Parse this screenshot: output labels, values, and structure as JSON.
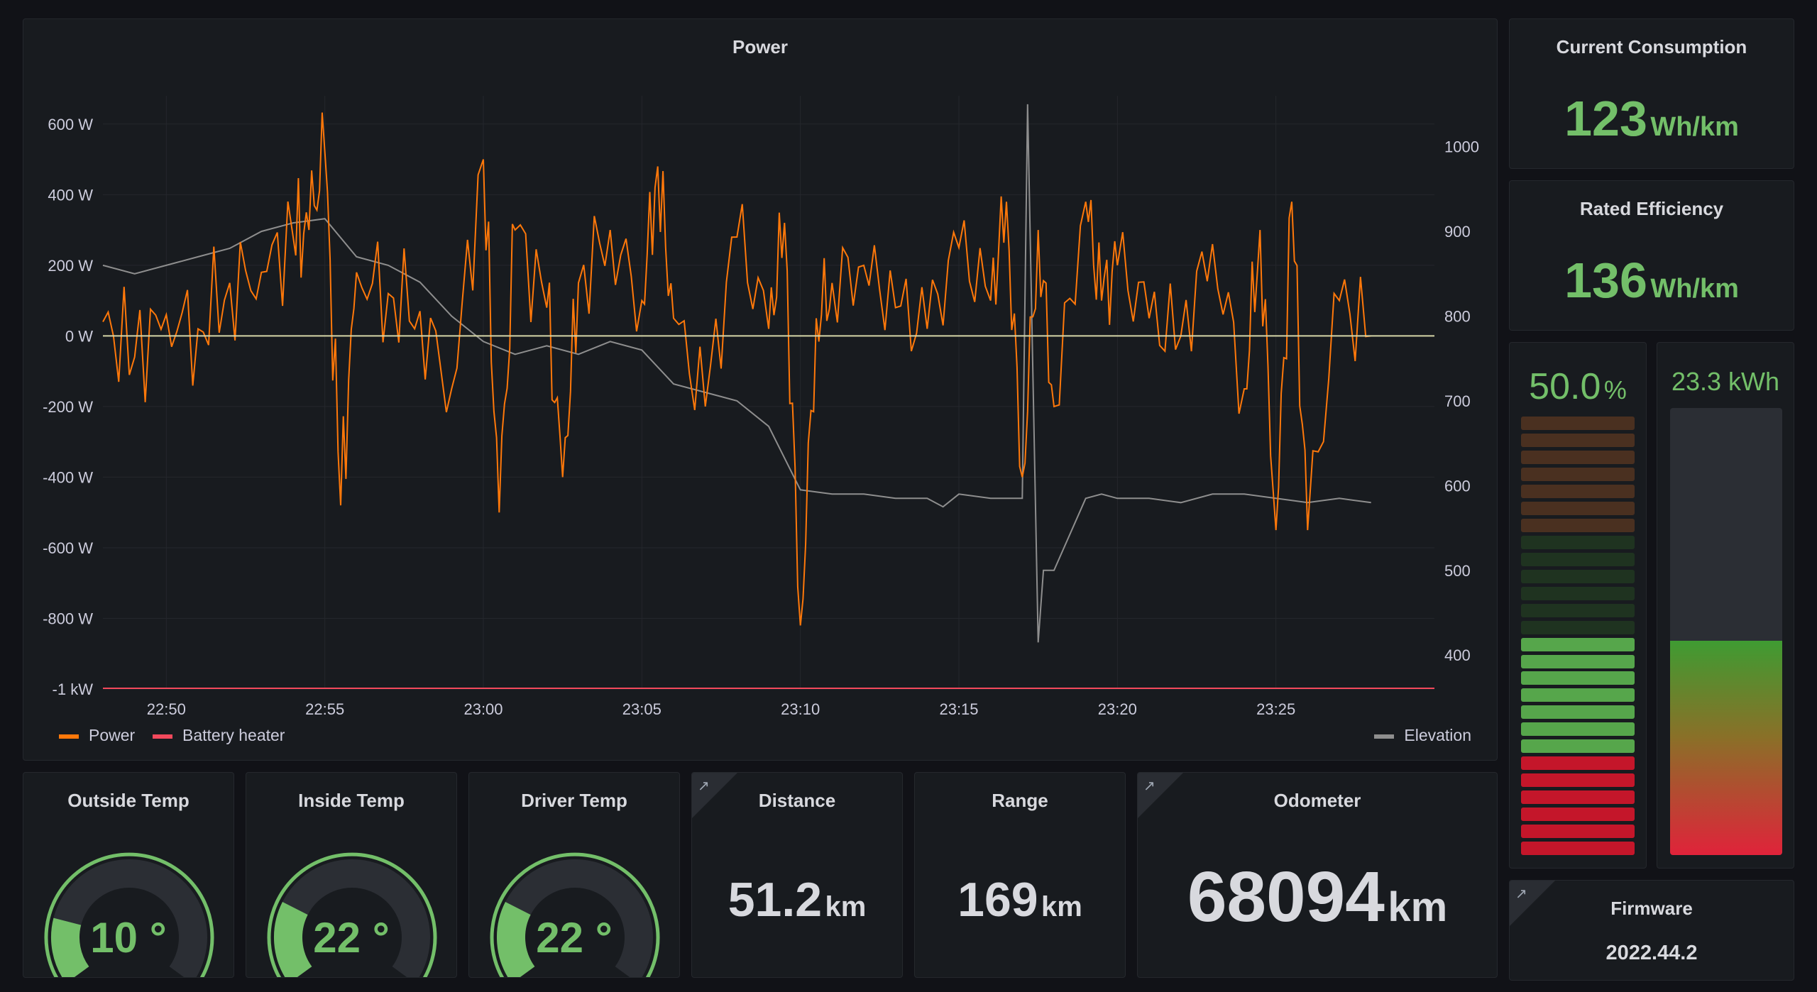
{
  "power_panel": {
    "title": "Power",
    "y_left_ticks": [
      "600 W",
      "400 W",
      "200 W",
      "0 W",
      "-200 W",
      "-400 W",
      "-600 W",
      "-800 W",
      "-1 kW"
    ],
    "y_right_ticks": [
      "1000",
      "900",
      "800",
      "700",
      "600",
      "500",
      "400"
    ],
    "x_ticks": [
      "22:50",
      "22:55",
      "23:00",
      "23:05",
      "23:10",
      "23:15",
      "23:20",
      "23:25"
    ],
    "legend": [
      {
        "name": "Power",
        "color": "#ff780a"
      },
      {
        "name": "Battery heater",
        "color": "#f2495c"
      },
      {
        "name": "Elevation",
        "color": "#8e8e8e"
      }
    ]
  },
  "chart_data": {
    "type": "line",
    "title": "Power",
    "x_label": "",
    "x_range": [
      "22:48",
      "23:30"
    ],
    "y_left_range": [
      -1000,
      680
    ],
    "y_right_range": [
      360,
      1060
    ],
    "series": [
      {
        "name": "Power",
        "axis": "left",
        "color": "#ff780a",
        "x": [
          "22:48",
          "22:49",
          "22:50",
          "22:51",
          "22:52",
          "22:53",
          "22:54",
          "22:54:30",
          "22:55",
          "22:55:30",
          "22:56",
          "22:57",
          "22:58",
          "22:59",
          "23:00",
          "23:00:30",
          "23:01",
          "23:02",
          "23:02:30",
          "23:03",
          "23:04",
          "23:05",
          "23:05:30",
          "23:06",
          "23:07",
          "23:08",
          "23:09",
          "23:09:30",
          "23:10",
          "23:10:30",
          "23:11",
          "23:12",
          "23:13",
          "23:14",
          "23:15",
          "23:16",
          "23:16:30",
          "23:17",
          "23:17:30",
          "23:18",
          "23:19",
          "23:19:30",
          "23:20",
          "23:21",
          "23:22",
          "23:23",
          "23:24",
          "23:24:30",
          "23:25",
          "23:25:30",
          "23:26",
          "23:27",
          "23:28"
        ],
        "values": [
          40,
          -60,
          60,
          20,
          150,
          180,
          280,
          300,
          520,
          -480,
          180,
          120,
          70,
          -150,
          500,
          -500,
          300,
          80,
          -400,
          150,
          300,
          100,
          480,
          50,
          -200,
          280,
          20,
          320,
          -820,
          50,
          150,
          200,
          80,
          20,
          250,
          100,
          380,
          -400,
          300,
          -200,
          380,
          100,
          200,
          50,
          0,
          260,
          -150,
          300,
          -550,
          380,
          -550,
          100,
          0
        ]
      },
      {
        "name": "Battery heater",
        "axis": "left",
        "color": "#f2495c",
        "x": [
          "22:48",
          "23:30"
        ],
        "values": [
          -1000,
          -1000
        ]
      },
      {
        "name": "Elevation",
        "axis": "right",
        "color": "#8e8e8e",
        "x": [
          "22:48",
          "22:49",
          "22:50",
          "22:51",
          "22:52",
          "22:53",
          "22:54",
          "22:55",
          "22:56",
          "22:57",
          "22:58",
          "22:59",
          "23:00",
          "23:01",
          "23:02",
          "23:03",
          "23:04",
          "23:05",
          "23:06",
          "23:07",
          "23:08",
          "23:09",
          "23:10",
          "23:11",
          "23:12",
          "23:13",
          "23:14",
          "23:14:30",
          "23:15",
          "23:16",
          "23:17",
          "23:17:10",
          "23:17:30",
          "23:17:40",
          "23:18",
          "23:19",
          "23:19:30",
          "23:20",
          "23:21",
          "23:22",
          "23:23",
          "23:24",
          "23:25",
          "23:26",
          "23:27",
          "23:28"
        ],
        "values": [
          860,
          850,
          860,
          870,
          880,
          900,
          910,
          915,
          870,
          860,
          840,
          800,
          770,
          755,
          765,
          755,
          770,
          760,
          720,
          710,
          700,
          670,
          595,
          590,
          590,
          585,
          585,
          575,
          590,
          585,
          585,
          1050,
          415,
          500,
          500,
          585,
          590,
          585,
          585,
          580,
          590,
          590,
          585,
          580,
          585,
          580
        ]
      }
    ]
  },
  "current_consumption": {
    "title": "Current Consumption",
    "value": "123",
    "unit": "Wh/km"
  },
  "rated_efficiency": {
    "title": "Rated Efficiency",
    "value": "136",
    "unit": "Wh/km"
  },
  "battery_level": {
    "value": "50.0",
    "unit": "%",
    "fraction": 0.5
  },
  "energy": {
    "value": "23.3 kWh",
    "fraction": 0.48
  },
  "outside_temp": {
    "title": "Outside Temp",
    "value": "10 °",
    "fraction": 0.2
  },
  "inside_temp": {
    "title": "Inside Temp",
    "value": "22 °",
    "fraction": 0.25
  },
  "driver_temp": {
    "title": "Driver Temp",
    "value": "22 °",
    "fraction": 0.25
  },
  "distance": {
    "title": "Distance",
    "value": "51.2",
    "unit": "km"
  },
  "range": {
    "title": "Range",
    "value": "169",
    "unit": "km"
  },
  "odometer": {
    "title": "Odometer",
    "value": "68094",
    "unit": "km"
  },
  "firmware": {
    "title": "Firmware",
    "value": "2022.44.2"
  },
  "colors": {
    "green": "#73bf69",
    "orange": "#ff780a",
    "red": "#f2495c",
    "panel": "#181b1f",
    "background": "#111217"
  },
  "icons": {
    "external_link": "external-link-icon"
  }
}
